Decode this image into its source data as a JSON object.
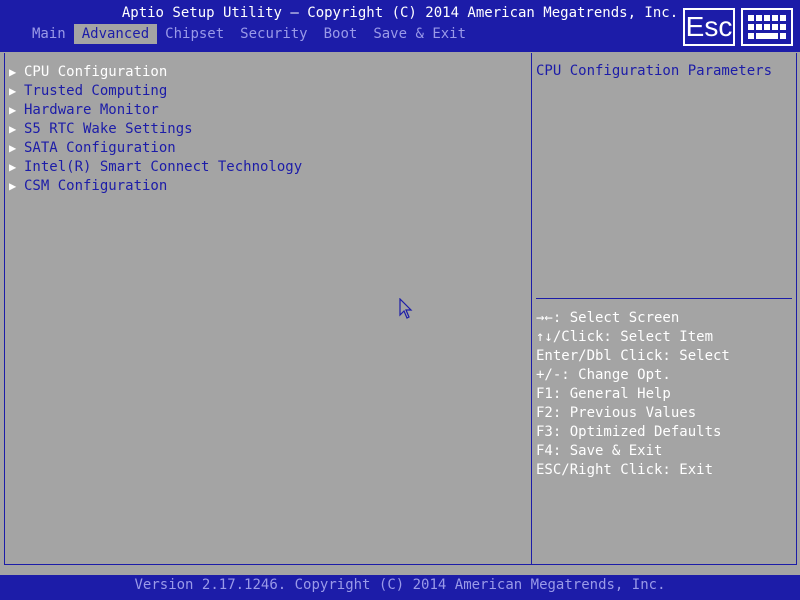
{
  "header": {
    "title": "Aptio Setup Utility – Copyright (C) 2014 American Megatrends, Inc.",
    "tabs": [
      {
        "label": "Main"
      },
      {
        "label": "Advanced"
      },
      {
        "label": "Chipset"
      },
      {
        "label": "Security"
      },
      {
        "label": "Boot"
      },
      {
        "label": "Save & Exit"
      }
    ],
    "active_tab": "Advanced",
    "esc_label": "Esc"
  },
  "menu": {
    "items": [
      {
        "label": "CPU Configuration"
      },
      {
        "label": "Trusted Computing"
      },
      {
        "label": "Hardware Monitor"
      },
      {
        "label": "S5 RTC Wake Settings"
      },
      {
        "label": "SATA Configuration"
      },
      {
        "label": "Intel(R) Smart Connect Technology"
      },
      {
        "label": "CSM Configuration"
      }
    ],
    "selected_index": 0
  },
  "help": {
    "text": "CPU Configuration Parameters"
  },
  "key_help": [
    "→←: Select Screen",
    "↑↓/Click: Select Item",
    "Enter/Dbl Click: Select",
    "+/-: Change Opt.",
    "F1: General Help",
    "F2: Previous Values",
    "F3: Optimized Defaults",
    "F4: Save & Exit",
    "ESC/Right Click: Exit"
  ],
  "footer": {
    "text": "Version 2.17.1246. Copyright (C) 2014 American Megatrends, Inc."
  },
  "colors": {
    "blue": "#1c1ca8",
    "gray": "#a4a4a4",
    "white": "#ffffff",
    "dim_text": "#9a9ae8"
  }
}
